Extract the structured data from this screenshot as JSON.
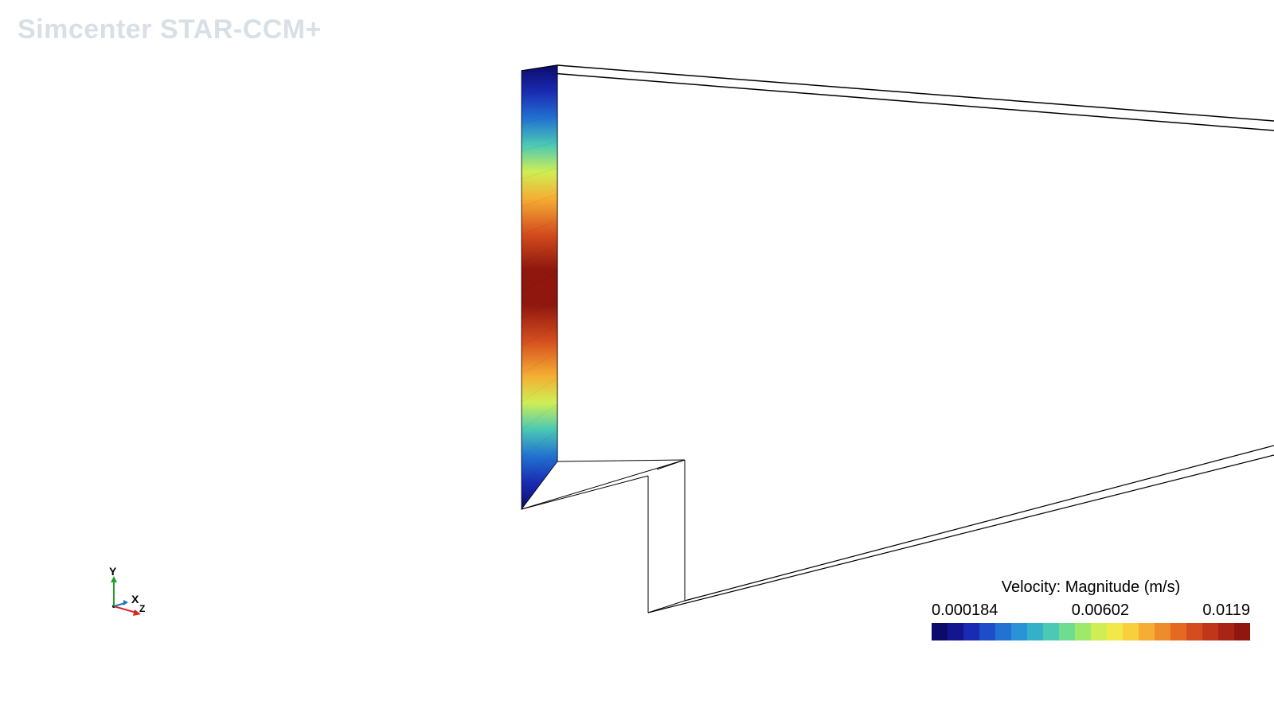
{
  "app": {
    "watermark": "Simcenter STAR-CCM+"
  },
  "triad": {
    "axes": {
      "y": "Y",
      "x": "X",
      "z": "Z"
    },
    "colors": {
      "y": "#22a02c",
      "x": "#d62728",
      "z": "#1f77b4"
    }
  },
  "legend": {
    "title": "Velocity: Magnitude (m/s)",
    "ticks": [
      "0.000184",
      "0.00602",
      "0.0119"
    ],
    "colors": [
      "#0b0b6b",
      "#13168f",
      "#1a2bb3",
      "#1f4cc8",
      "#2272d1",
      "#2993d6",
      "#34b1c9",
      "#4bc9b4",
      "#6fdc90",
      "#9fe96a",
      "#cfee55",
      "#f2e84a",
      "#f8cf3d",
      "#f5ae33",
      "#ee8b2b",
      "#e46a24",
      "#d44d1e",
      "#c03618",
      "#a82513",
      "#8f170e"
    ]
  },
  "scene": {
    "scalar_field": "Velocity: Magnitude",
    "unit": "m/s",
    "inlet_profile_note": "Parabolic-like profile: low at top/bottom, max near mid-height",
    "geometry": "Backward-facing step channel wireframe with colored inlet plane"
  }
}
